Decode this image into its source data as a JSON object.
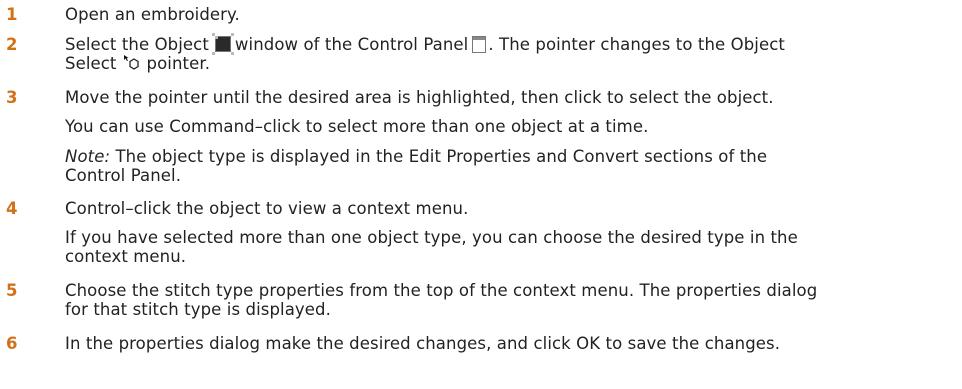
{
  "steps": [
    {
      "number": "1",
      "lines": [
        "Open an embroidery."
      ]
    },
    {
      "number": "2",
      "line1_a": "Select the Object",
      "line1_b": "window of the Control Panel",
      "line1_c": ". The pointer changes to the Object",
      "line2_a": "Select",
      "line2_b": "pointer."
    },
    {
      "number": "3",
      "lines": [
        "Move the pointer until the desired area is highlighted, then click to select the object.",
        "You can use Command–click to select more than one object at a time."
      ],
      "note_label": "Note:",
      "note_line1": " The object type is displayed in the Edit Properties and Convert sections of the",
      "note_line2": "Control Panel."
    },
    {
      "number": "4",
      "lines": [
        "Control–click the object to view a context menu.",
        "If you have selected more than one object type, you can choose the desired type in the",
        "context menu."
      ]
    },
    {
      "number": "5",
      "lines": [
        "Choose the stitch type properties from the top of the context menu. The properties dialog",
        "for that stitch type is displayed."
      ]
    },
    {
      "number": "6",
      "lines": [
        "In the properties dialog make the desired changes, and click OK to save the changes."
      ]
    }
  ],
  "icons": {
    "object_window": "object-window-icon",
    "control_panel": "control-panel-icon",
    "object_select_pointer": "object-select-pointer-icon"
  },
  "colors": {
    "step_number": "#d3701a",
    "text": "#222222"
  }
}
